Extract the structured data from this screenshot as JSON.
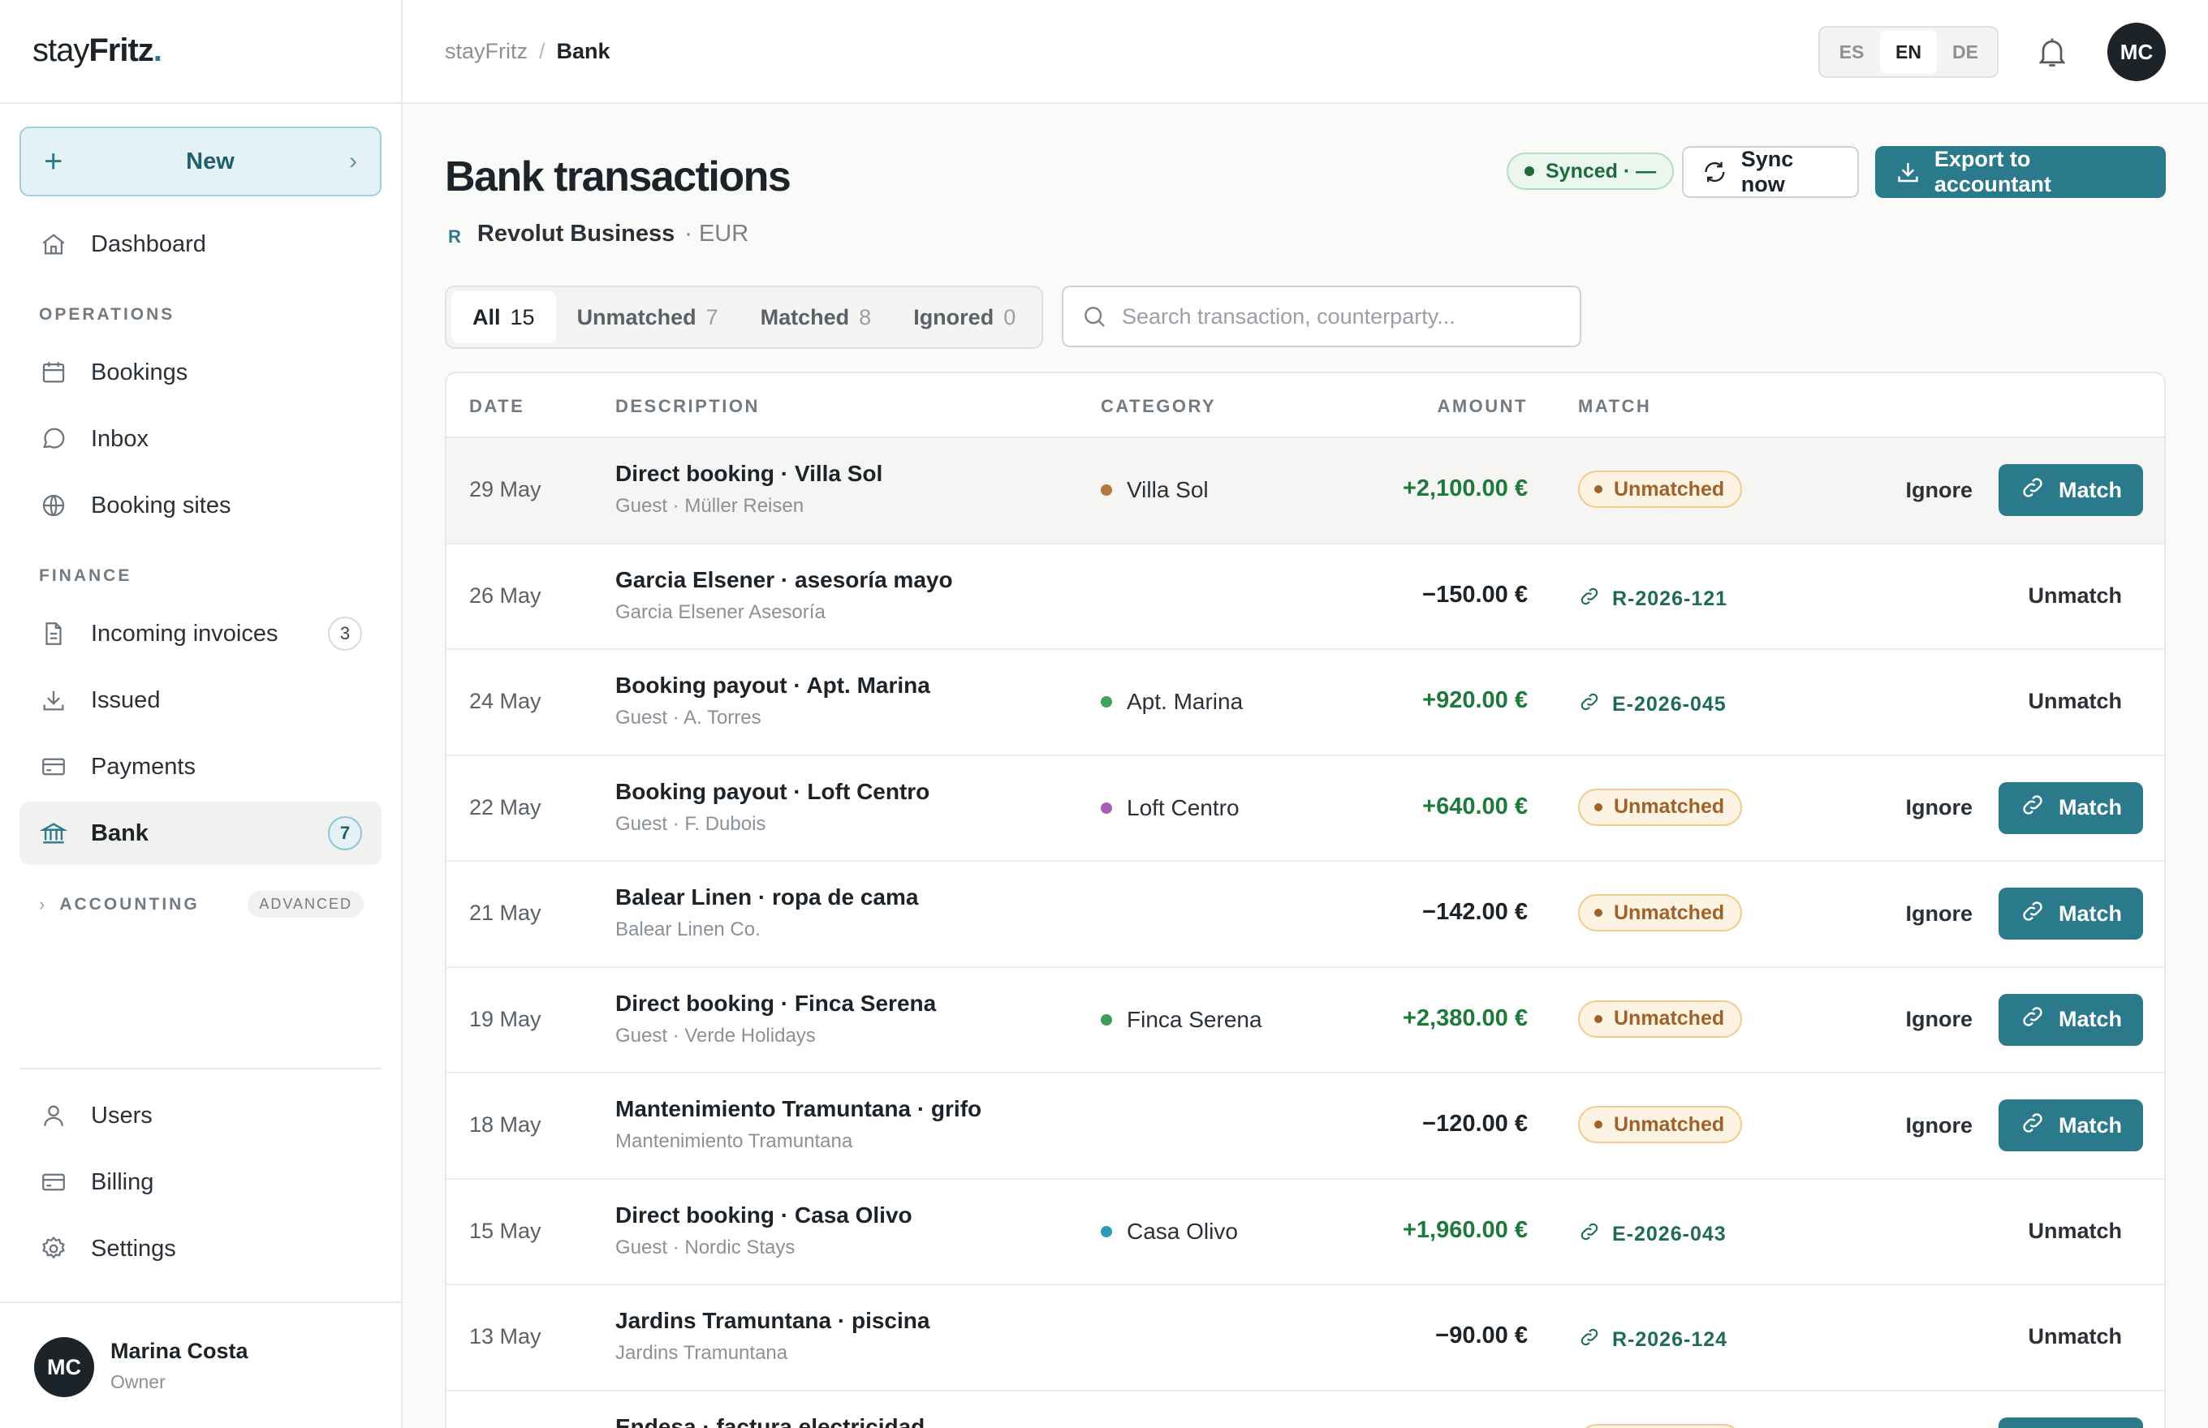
{
  "app": {
    "logo_prefix": "stay",
    "logo_bold": "Fritz",
    "logo_dot": "."
  },
  "sidebar": {
    "new_label": "New",
    "dashboard": "Dashboard",
    "operations_label": "OPERATIONS",
    "bookings": "Bookings",
    "inbox": "Inbox",
    "booking_sites": "Booking sites",
    "finance_label": "FINANCE",
    "incoming_invoices": "Incoming invoices",
    "incoming_invoices_count": "3",
    "issued": "Issued",
    "payments": "Payments",
    "bank": "Bank",
    "bank_count": "7",
    "accounting_label": "ACCOUNTING",
    "advanced_badge": "ADVANCED",
    "users": "Users",
    "billing": "Billing",
    "settings": "Settings",
    "user": {
      "initials": "MC",
      "name": "Marina Costa",
      "role": "Owner"
    }
  },
  "topbar": {
    "breadcrumb_root": "stayFritz",
    "breadcrumb_sep": "/",
    "breadcrumb_current": "Bank",
    "languages": [
      "ES",
      "EN",
      "DE"
    ],
    "active_language": "EN",
    "avatar_initials": "MC"
  },
  "page": {
    "title": "Bank transactions",
    "bank_mark": "R",
    "bank_name": "Revolut Business",
    "currency": "· EUR",
    "synced_label": "Synced · —",
    "sync_now_label": "Sync now",
    "export_label": "Export to accountant"
  },
  "filters": [
    {
      "label": "All",
      "count": "15"
    },
    {
      "label": "Unmatched",
      "count": "7"
    },
    {
      "label": "Matched",
      "count": "8"
    },
    {
      "label": "Ignored",
      "count": "0"
    }
  ],
  "search": {
    "placeholder": "Search transaction, counterparty..."
  },
  "table": {
    "columns": {
      "date": "DATE",
      "description": "DESCRIPTION",
      "category": "CATEGORY",
      "amount": "AMOUNT",
      "match": "MATCH"
    },
    "ignore_label": "Ignore",
    "match_label": "Match",
    "unmatch_label": "Unmatch",
    "rows": [
      {
        "date": "29 May",
        "title": "Direct booking · Villa Sol",
        "sub": "Guest · Müller Reisen",
        "category": "Villa Sol",
        "cat_color": "#b07a3a",
        "amount": "+2,100.00 €",
        "sign": "pos",
        "status": "Unmatched",
        "ref": ""
      },
      {
        "date": "26 May",
        "title": "Garcia Elsener · asesoría mayo",
        "sub": "Garcia Elsener Asesoría",
        "category": "",
        "cat_color": "",
        "amount": "−150.00 €",
        "sign": "neg",
        "status": "",
        "ref": "R-2026-121"
      },
      {
        "date": "24 May",
        "title": "Booking payout · Apt. Marina",
        "sub": "Guest · A. Torres",
        "category": "Apt. Marina",
        "cat_color": "#3fa55a",
        "amount": "+920.00 €",
        "sign": "pos",
        "status": "",
        "ref": "E-2026-045"
      },
      {
        "date": "22 May",
        "title": "Booking payout · Loft Centro",
        "sub": "Guest · F. Dubois",
        "category": "Loft Centro",
        "cat_color": "#a65fb5",
        "amount": "+640.00 €",
        "sign": "pos",
        "status": "Unmatched",
        "ref": ""
      },
      {
        "date": "21 May",
        "title": "Balear Linen · ropa de cama",
        "sub": "Balear Linen Co.",
        "category": "",
        "cat_color": "",
        "amount": "−142.00 €",
        "sign": "neg",
        "status": "Unmatched",
        "ref": ""
      },
      {
        "date": "19 May",
        "title": "Direct booking · Finca Serena",
        "sub": "Guest · Verde Holidays",
        "category": "Finca Serena",
        "cat_color": "#3f9b5a",
        "amount": "+2,380.00 €",
        "sign": "pos",
        "status": "Unmatched",
        "ref": ""
      },
      {
        "date": "18 May",
        "title": "Mantenimiento Tramuntana · grifo",
        "sub": "Mantenimiento Tramuntana",
        "category": "",
        "cat_color": "",
        "amount": "−120.00 €",
        "sign": "neg",
        "status": "Unmatched",
        "ref": ""
      },
      {
        "date": "15 May",
        "title": "Direct booking · Casa Olivo",
        "sub": "Guest · Nordic Stays",
        "category": "Casa Olivo",
        "cat_color": "#2a9cb8",
        "amount": "+1,960.00 €",
        "sign": "pos",
        "status": "",
        "ref": "E-2026-043"
      },
      {
        "date": "13 May",
        "title": "Jardins Tramuntana · piscina",
        "sub": "Jardins Tramuntana",
        "category": "",
        "cat_color": "",
        "amount": "−90.00 €",
        "sign": "neg",
        "status": "",
        "ref": "R-2026-124"
      },
      {
        "date": "",
        "title": "Endesa · factura electricidad",
        "sub": "",
        "category": "",
        "cat_color": "",
        "amount": "",
        "sign": "neg",
        "status": "Unmatched",
        "ref": ""
      }
    ]
  }
}
